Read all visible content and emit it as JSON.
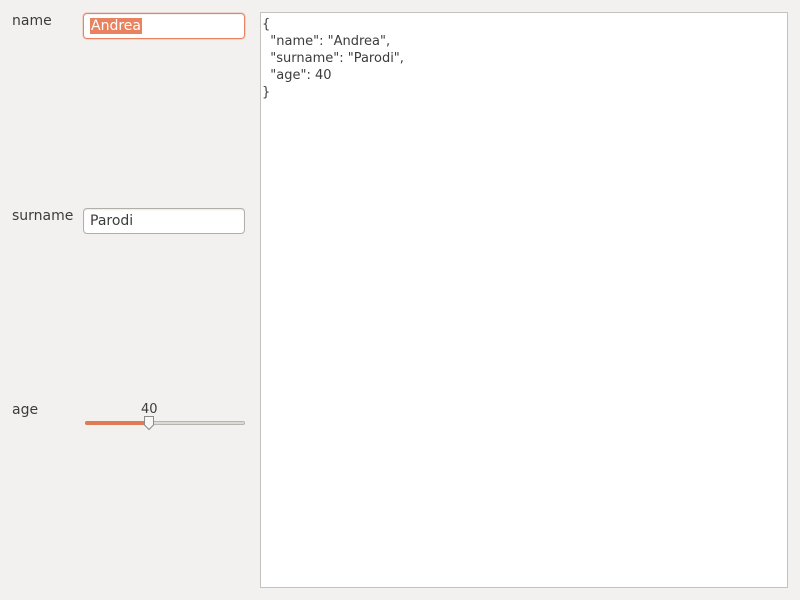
{
  "form": {
    "name": {
      "label": "name",
      "value": "Andrea"
    },
    "surname": {
      "label": "surname",
      "value": "Parodi"
    },
    "age": {
      "label": "age",
      "value": "40",
      "fraction": 0.4
    }
  },
  "json_view": {
    "text": "{\n  \"name\": \"Andrea\",\n  \"surname\": \"Parodi\",\n  \"age\": 40\n}"
  },
  "colors": {
    "accent": "#e9825e",
    "window_bg": "#f2f1f0",
    "text": "#3c3c3c"
  }
}
